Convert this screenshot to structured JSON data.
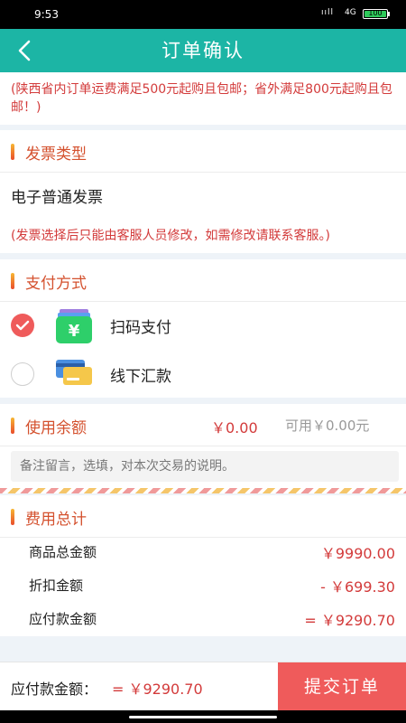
{
  "status_bar": {
    "time": "9:53",
    "signal": "ııll",
    "network": "4G",
    "battery": "100"
  },
  "header": {
    "title": "订单确认"
  },
  "notice": "(陕西省内订单运费满足500元起购且包邮；省外满足800元起购且包邮！)",
  "invoice": {
    "section_title": "发票类型",
    "type": "电子普通发票",
    "note": "(发票选择后只能由客服人员修改，如需修改请联系客服。)"
  },
  "payment": {
    "section_title": "支付方式",
    "options": [
      {
        "label": "扫码支付",
        "icon": "yen-wallet-icon",
        "selected": true
      },
      {
        "label": "线下汇款",
        "icon": "bank-card-icon",
        "selected": false
      }
    ]
  },
  "balance": {
    "label": "使用余额",
    "amount": "￥0.00",
    "available": "可用￥0.00元"
  },
  "remark": {
    "placeholder": "备注留言，选填，对本次交易的说明。"
  },
  "fees": {
    "section_title": "费用总计",
    "rows": [
      {
        "label": "商品总金额",
        "value": "￥9990.00"
      },
      {
        "label": "折扣金额",
        "value": "- ￥699.30"
      },
      {
        "label": "应付款金额",
        "value": "= ￥9290.70"
      }
    ]
  },
  "footer": {
    "payable_label": "应付款金额：",
    "payable_total": "= ￥9290.70",
    "submit_label": "提交订单"
  },
  "colors": {
    "header": "#1cb5a5",
    "accent_red": "#ef5b5b",
    "text_red": "#d33b3b",
    "section_title": "#d4512e"
  }
}
